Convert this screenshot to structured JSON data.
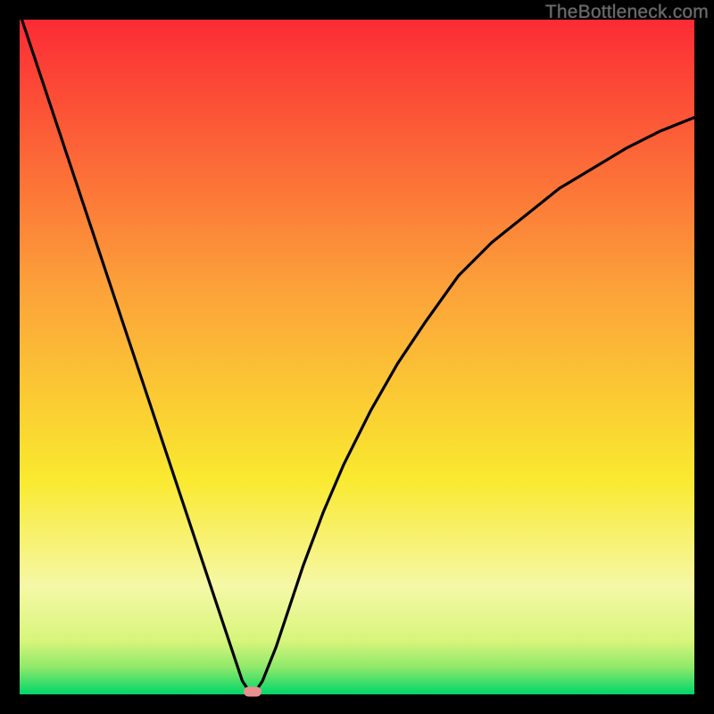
{
  "watermark": "TheBottleneck.com",
  "colors": {
    "bg_black": "#000000",
    "grad_top": "#fc2b35",
    "grad_mid1": "#f9a733",
    "grad_mid2": "#f6e72e",
    "grad_mid3": "#f3f99b",
    "grad_bottom": "#00d66a",
    "curve": "#000000",
    "marker": "#e98f8f"
  },
  "chart_data": {
    "type": "line",
    "title": "",
    "xlabel": "",
    "ylabel": "",
    "xlim": [
      0,
      100
    ],
    "ylim": [
      0,
      100
    ],
    "series": [
      {
        "name": "bottleneck-curve",
        "x": [
          0,
          2,
          4,
          6,
          8,
          10,
          12,
          14,
          16,
          18,
          20,
          22,
          24,
          26,
          28,
          30,
          32,
          33,
          34,
          35,
          36,
          38,
          40,
          42,
          45,
          48,
          52,
          56,
          60,
          65,
          70,
          75,
          80,
          85,
          90,
          95,
          100
        ],
        "y": [
          101,
          95,
          89,
          83,
          77,
          71,
          65,
          59,
          53,
          47,
          41,
          35,
          29,
          23,
          17,
          11,
          5,
          2,
          0.5,
          0.5,
          2,
          7,
          13,
          19,
          27,
          34,
          42,
          49,
          55,
          62,
          67,
          71,
          75,
          78,
          81,
          83.5,
          85.5
        ]
      }
    ],
    "marker": {
      "x": 34.5,
      "y": 0,
      "label": ""
    },
    "gradient_stops": [
      {
        "pct": 0,
        "color": "#fc2b35"
      },
      {
        "pct": 40,
        "color": "#fca23a"
      },
      {
        "pct": 68,
        "color": "#fae92f"
      },
      {
        "pct": 84,
        "color": "#f5f8a6"
      },
      {
        "pct": 92,
        "color": "#d8f57c"
      },
      {
        "pct": 96,
        "color": "#8fe96a"
      },
      {
        "pct": 100,
        "color": "#00d66a"
      }
    ]
  }
}
